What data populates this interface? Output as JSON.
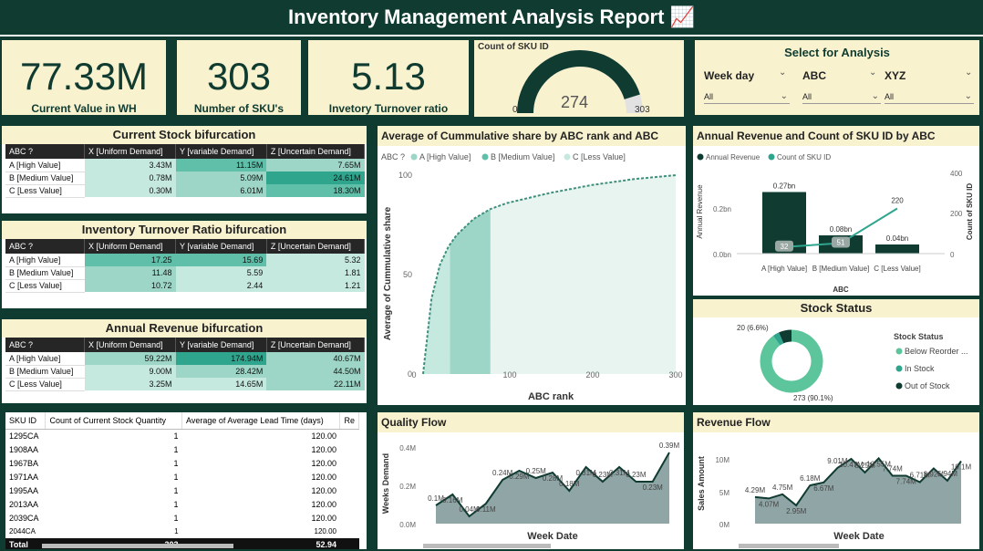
{
  "header": {
    "title": "Inventory Management Analysis Report 📈"
  },
  "kpis": [
    {
      "value": "77.33M",
      "label": "Current Value in WH"
    },
    {
      "value": "303",
      "label": "Number of SKU's"
    },
    {
      "value": "5.13",
      "label": "Invetory Turnover ratio"
    }
  ],
  "gauge": {
    "title": "Count of SKU ID",
    "value": "274",
    "min": "0",
    "max": "303",
    "fraction": 0.904
  },
  "filters": {
    "title": "Select for Analysis",
    "items": [
      {
        "label": "Week day",
        "value": "All"
      },
      {
        "label": "ABC",
        "value": "All"
      },
      {
        "label": "XYZ",
        "value": "All"
      }
    ]
  },
  "matrix_headers": [
    "ABC ?",
    "X [Uniform Demand]",
    "Y [variable Demand]",
    "Z [Uncertain Demand]"
  ],
  "row_labels": [
    "A [High Value]",
    "B [Medium Value]",
    "C [Less Value]"
  ],
  "stock": {
    "title": "Current Stock bifurcation",
    "rows": [
      [
        "3.43M",
        "11.15M",
        "7.65M"
      ],
      [
        "0.78M",
        "5.09M",
        "24.61M"
      ],
      [
        "0.30M",
        "6.01M",
        "18.30M"
      ]
    ]
  },
  "turnover": {
    "title": "Inventory Turnover Ratio bifurcation",
    "rows": [
      [
        "17.25",
        "15.69",
        "5.32"
      ],
      [
        "11.48",
        "5.59",
        "1.81"
      ],
      [
        "10.72",
        "2.44",
        "1.21"
      ]
    ]
  },
  "revenue_matrix": {
    "title": "Annual Revenue bifurcation",
    "rows": [
      [
        "59.22M",
        "174.94M",
        "40.67M"
      ],
      [
        "9.00M",
        "28.42M",
        "44.50M"
      ],
      [
        "3.25M",
        "14.65M",
        "22.11M"
      ]
    ]
  },
  "sku_table": {
    "headers": [
      "SKU ID",
      "Count of Current Stock Quantity",
      "Average of Average Lead Time (days)",
      "Re"
    ],
    "rows": [
      [
        "1295CA",
        "1",
        "120.00"
      ],
      [
        "1908AA",
        "1",
        "120.00"
      ],
      [
        "1967BA",
        "1",
        "120.00"
      ],
      [
        "1971AA",
        "1",
        "120.00"
      ],
      [
        "1995AA",
        "1",
        "120.00"
      ],
      [
        "2013AA",
        "1",
        "120.00"
      ],
      [
        "2039CA",
        "1",
        "120.00"
      ],
      [
        "2044CA",
        "1",
        "120.00"
      ]
    ],
    "total": [
      "Total",
      "303",
      "52.94"
    ]
  },
  "cumulative_chart": {
    "title": "Average of Cummulative share by ABC rank and ABC",
    "legend_title": "ABC ?",
    "legend": [
      "A [High Value]",
      "B [Medium Value]",
      "C [Less Value]"
    ],
    "xlabel": "ABC rank",
    "ylabel": "Average of Cummulative share",
    "xticks": [
      "0",
      "100",
      "200",
      "300"
    ],
    "yticks": [
      "0",
      "50",
      "100"
    ]
  },
  "abc_chart": {
    "title": "Annual Revenue and Count of SKU ID by ABC",
    "legend": [
      "Annual Revenue",
      "Count of SKU ID"
    ],
    "categories": [
      "A [High Value]",
      "B [Medium Value]",
      "C [Less Value]"
    ],
    "xlabel": "ABC",
    "ylabel_left": "Annual Revenue",
    "ylabel_right": "Count of SKU ID",
    "bar_labels": [
      "0.27bn",
      "0.08bn",
      "0.04bn"
    ],
    "line_labels": [
      "32",
      "51",
      "220"
    ],
    "yticks_left": [
      "0.0bn",
      "0.2bn"
    ],
    "yticks_right": [
      "0",
      "200",
      "400"
    ]
  },
  "stock_status": {
    "title": "Stock Status",
    "legend_title": "Stock Status",
    "legend": [
      "Below Reorder ...",
      "In Stock",
      "Out of Stock"
    ],
    "label_small": "20 (6.6%)",
    "label_large": "273 (90.1%)"
  },
  "quality_flow": {
    "title": "Quality Flow",
    "xlabel": "Week Date",
    "ylabel": "Weeks Demand",
    "yticks": [
      "0.0M",
      "0.2M",
      "0.4M"
    ],
    "point_labels": [
      "0.1M",
      "0.16M",
      "0.04M",
      "0.11M",
      "0.24M",
      "0.29M",
      "0.25M",
      "0.28M",
      "0.18M",
      "0.31M",
      "0.23M",
      "0.31M",
      "0.23M",
      "0.23M",
      "0.39M"
    ]
  },
  "revenue_flow": {
    "title": "Revenue Flow",
    "xlabel": "Week Date",
    "ylabel": "Sales Amount",
    "yticks": [
      "0M",
      "5M",
      "10M"
    ],
    "point_labels": [
      "4.29M",
      "4.07M",
      "4.75M",
      "2.95M",
      "6.18M",
      "6.67M",
      "9.01M",
      "10.47M",
      "8.25M",
      "10.55M",
      "7.74M",
      "7.74M",
      "6.71M",
      "8.92M",
      "6.94M",
      "10.1M"
    ]
  },
  "chart_data": [
    {
      "type": "area",
      "title": "Average of Cummulative share by ABC rank and ABC",
      "x": [
        0,
        10,
        20,
        30,
        40,
        60,
        80,
        100,
        150,
        200,
        250,
        300
      ],
      "series": [
        {
          "name": "Cumulative share",
          "values": [
            0,
            38,
            55,
            64,
            70,
            78,
            83,
            86,
            91,
            95,
            98,
            100
          ]
        }
      ],
      "xlabel": "ABC rank",
      "ylabel": "Average of Cummulative share",
      "xlim": [
        0,
        300
      ],
      "ylim": [
        0,
        100
      ]
    },
    {
      "type": "bar",
      "title": "Annual Revenue and Count of SKU ID by ABC",
      "categories": [
        "A [High Value]",
        "B [Medium Value]",
        "C [Less Value]"
      ],
      "series": [
        {
          "name": "Annual Revenue",
          "values": [
            0.27,
            0.08,
            0.04
          ]
        },
        {
          "name": "Count of SKU ID",
          "values": [
            32,
            51,
            220
          ]
        }
      ]
    },
    {
      "type": "pie",
      "title": "Stock Status",
      "categories": [
        "Below Reorder ...",
        "In Stock",
        "Out of Stock"
      ],
      "values": [
        273,
        10,
        20
      ]
    },
    {
      "type": "area",
      "title": "Quality Flow",
      "series": [
        {
          "name": "Weeks Demand",
          "values": [
            0.1,
            0.16,
            0.04,
            0.11,
            0.24,
            0.29,
            0.25,
            0.28,
            0.18,
            0.31,
            0.23,
            0.31,
            0.23,
            0.23,
            0.39
          ]
        }
      ],
      "ylim": [
        0,
        0.45
      ]
    },
    {
      "type": "area",
      "title": "Revenue Flow",
      "series": [
        {
          "name": "Sales Amount",
          "values": [
            4.29,
            4.07,
            4.75,
            2.95,
            6.18,
            6.67,
            9.01,
            10.47,
            8.25,
            10.55,
            7.74,
            7.74,
            6.71,
            8.92,
            6.94,
            10.1
          ]
        }
      ],
      "ylim": [
        0,
        12
      ]
    }
  ],
  "colors": {
    "dark": "#0f3b30",
    "teal": "#2fa58e",
    "light": "#5fbfa9",
    "pale": "#9dd6c6",
    "cream": "#f8f2cf"
  }
}
